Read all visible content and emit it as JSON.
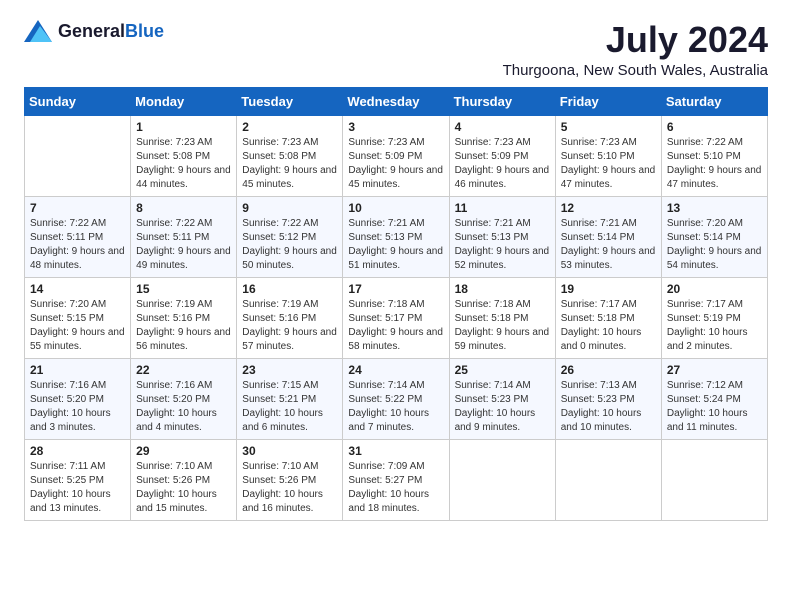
{
  "logo": {
    "general": "General",
    "blue": "Blue"
  },
  "title": {
    "month_year": "July 2024",
    "location": "Thurgoona, New South Wales, Australia"
  },
  "days_of_week": [
    "Sunday",
    "Monday",
    "Tuesday",
    "Wednesday",
    "Thursday",
    "Friday",
    "Saturday"
  ],
  "weeks": [
    [
      {
        "day": "",
        "sunrise": "",
        "sunset": "",
        "daylight": ""
      },
      {
        "day": "1",
        "sunrise": "Sunrise: 7:23 AM",
        "sunset": "Sunset: 5:08 PM",
        "daylight": "Daylight: 9 hours and 44 minutes."
      },
      {
        "day": "2",
        "sunrise": "Sunrise: 7:23 AM",
        "sunset": "Sunset: 5:08 PM",
        "daylight": "Daylight: 9 hours and 45 minutes."
      },
      {
        "day": "3",
        "sunrise": "Sunrise: 7:23 AM",
        "sunset": "Sunset: 5:09 PM",
        "daylight": "Daylight: 9 hours and 45 minutes."
      },
      {
        "day": "4",
        "sunrise": "Sunrise: 7:23 AM",
        "sunset": "Sunset: 5:09 PM",
        "daylight": "Daylight: 9 hours and 46 minutes."
      },
      {
        "day": "5",
        "sunrise": "Sunrise: 7:23 AM",
        "sunset": "Sunset: 5:10 PM",
        "daylight": "Daylight: 9 hours and 47 minutes."
      },
      {
        "day": "6",
        "sunrise": "Sunrise: 7:22 AM",
        "sunset": "Sunset: 5:10 PM",
        "daylight": "Daylight: 9 hours and 47 minutes."
      }
    ],
    [
      {
        "day": "7",
        "sunrise": "Sunrise: 7:22 AM",
        "sunset": "Sunset: 5:11 PM",
        "daylight": "Daylight: 9 hours and 48 minutes."
      },
      {
        "day": "8",
        "sunrise": "Sunrise: 7:22 AM",
        "sunset": "Sunset: 5:11 PM",
        "daylight": "Daylight: 9 hours and 49 minutes."
      },
      {
        "day": "9",
        "sunrise": "Sunrise: 7:22 AM",
        "sunset": "Sunset: 5:12 PM",
        "daylight": "Daylight: 9 hours and 50 minutes."
      },
      {
        "day": "10",
        "sunrise": "Sunrise: 7:21 AM",
        "sunset": "Sunset: 5:13 PM",
        "daylight": "Daylight: 9 hours and 51 minutes."
      },
      {
        "day": "11",
        "sunrise": "Sunrise: 7:21 AM",
        "sunset": "Sunset: 5:13 PM",
        "daylight": "Daylight: 9 hours and 52 minutes."
      },
      {
        "day": "12",
        "sunrise": "Sunrise: 7:21 AM",
        "sunset": "Sunset: 5:14 PM",
        "daylight": "Daylight: 9 hours and 53 minutes."
      },
      {
        "day": "13",
        "sunrise": "Sunrise: 7:20 AM",
        "sunset": "Sunset: 5:14 PM",
        "daylight": "Daylight: 9 hours and 54 minutes."
      }
    ],
    [
      {
        "day": "14",
        "sunrise": "Sunrise: 7:20 AM",
        "sunset": "Sunset: 5:15 PM",
        "daylight": "Daylight: 9 hours and 55 minutes."
      },
      {
        "day": "15",
        "sunrise": "Sunrise: 7:19 AM",
        "sunset": "Sunset: 5:16 PM",
        "daylight": "Daylight: 9 hours and 56 minutes."
      },
      {
        "day": "16",
        "sunrise": "Sunrise: 7:19 AM",
        "sunset": "Sunset: 5:16 PM",
        "daylight": "Daylight: 9 hours and 57 minutes."
      },
      {
        "day": "17",
        "sunrise": "Sunrise: 7:18 AM",
        "sunset": "Sunset: 5:17 PM",
        "daylight": "Daylight: 9 hours and 58 minutes."
      },
      {
        "day": "18",
        "sunrise": "Sunrise: 7:18 AM",
        "sunset": "Sunset: 5:18 PM",
        "daylight": "Daylight: 9 hours and 59 minutes."
      },
      {
        "day": "19",
        "sunrise": "Sunrise: 7:17 AM",
        "sunset": "Sunset: 5:18 PM",
        "daylight": "Daylight: 10 hours and 0 minutes."
      },
      {
        "day": "20",
        "sunrise": "Sunrise: 7:17 AM",
        "sunset": "Sunset: 5:19 PM",
        "daylight": "Daylight: 10 hours and 2 minutes."
      }
    ],
    [
      {
        "day": "21",
        "sunrise": "Sunrise: 7:16 AM",
        "sunset": "Sunset: 5:20 PM",
        "daylight": "Daylight: 10 hours and 3 minutes."
      },
      {
        "day": "22",
        "sunrise": "Sunrise: 7:16 AM",
        "sunset": "Sunset: 5:20 PM",
        "daylight": "Daylight: 10 hours and 4 minutes."
      },
      {
        "day": "23",
        "sunrise": "Sunrise: 7:15 AM",
        "sunset": "Sunset: 5:21 PM",
        "daylight": "Daylight: 10 hours and 6 minutes."
      },
      {
        "day": "24",
        "sunrise": "Sunrise: 7:14 AM",
        "sunset": "Sunset: 5:22 PM",
        "daylight": "Daylight: 10 hours and 7 minutes."
      },
      {
        "day": "25",
        "sunrise": "Sunrise: 7:14 AM",
        "sunset": "Sunset: 5:23 PM",
        "daylight": "Daylight: 10 hours and 9 minutes."
      },
      {
        "day": "26",
        "sunrise": "Sunrise: 7:13 AM",
        "sunset": "Sunset: 5:23 PM",
        "daylight": "Daylight: 10 hours and 10 minutes."
      },
      {
        "day": "27",
        "sunrise": "Sunrise: 7:12 AM",
        "sunset": "Sunset: 5:24 PM",
        "daylight": "Daylight: 10 hours and 11 minutes."
      }
    ],
    [
      {
        "day": "28",
        "sunrise": "Sunrise: 7:11 AM",
        "sunset": "Sunset: 5:25 PM",
        "daylight": "Daylight: 10 hours and 13 minutes."
      },
      {
        "day": "29",
        "sunrise": "Sunrise: 7:10 AM",
        "sunset": "Sunset: 5:26 PM",
        "daylight": "Daylight: 10 hours and 15 minutes."
      },
      {
        "day": "30",
        "sunrise": "Sunrise: 7:10 AM",
        "sunset": "Sunset: 5:26 PM",
        "daylight": "Daylight: 10 hours and 16 minutes."
      },
      {
        "day": "31",
        "sunrise": "Sunrise: 7:09 AM",
        "sunset": "Sunset: 5:27 PM",
        "daylight": "Daylight: 10 hours and 18 minutes."
      },
      {
        "day": "",
        "sunrise": "",
        "sunset": "",
        "daylight": ""
      },
      {
        "day": "",
        "sunrise": "",
        "sunset": "",
        "daylight": ""
      },
      {
        "day": "",
        "sunrise": "",
        "sunset": "",
        "daylight": ""
      }
    ]
  ]
}
